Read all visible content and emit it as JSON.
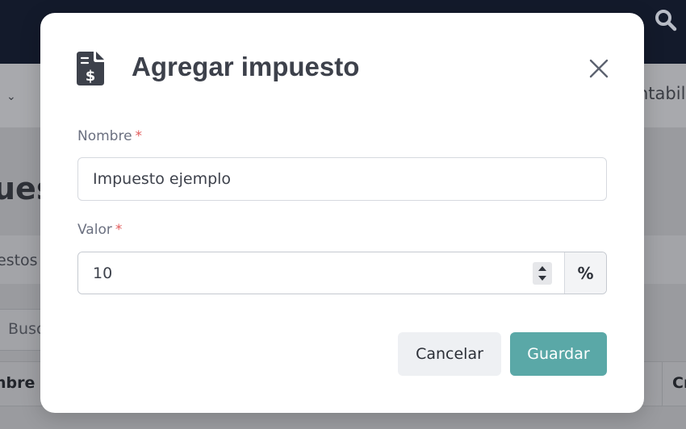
{
  "background": {
    "nav_right_text": "ntabili",
    "page_title_partial": "ues",
    "tab_partial": "estos",
    "search_partial": "Busc",
    "table_header_left": "nbre",
    "table_header_right": "Cr"
  },
  "modal": {
    "title": "Agregar impuesto",
    "icon": "file-invoice-dollar-icon",
    "fields": {
      "name": {
        "label": "Nombre",
        "required_mark": "*",
        "value": "Impuesto ejemplo"
      },
      "value": {
        "label": "Valor",
        "required_mark": "*",
        "value": "10",
        "addon": "%"
      }
    },
    "buttons": {
      "cancel": "Cancelar",
      "save": "Guardar"
    }
  },
  "colors": {
    "accent": "#5aa8a7",
    "required": "#e25b5b",
    "topbar": "#131a2b"
  }
}
